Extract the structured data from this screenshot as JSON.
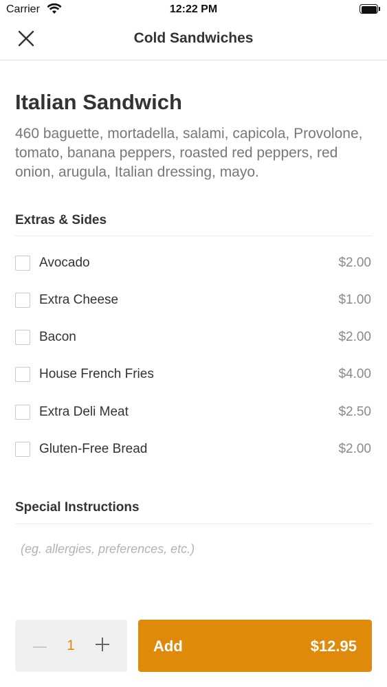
{
  "status_bar": {
    "carrier": "Carrier",
    "time": "12:22 PM"
  },
  "header": {
    "title": "Cold Sandwiches",
    "close_icon": "close-icon"
  },
  "item": {
    "name": "Italian Sandwich",
    "description": "460 baguette, mortadella, salami, capicola, Provolone, tomato, banana peppers, roasted red peppers, red onion, arugula, Italian dressing, mayo."
  },
  "extras": {
    "title": "Extras & Sides",
    "options": [
      {
        "name": "Avocado",
        "price": "$2.00",
        "checked": false
      },
      {
        "name": "Extra Cheese",
        "price": "$1.00",
        "checked": false
      },
      {
        "name": "Bacon",
        "price": "$2.00",
        "checked": false
      },
      {
        "name": "House French Fries",
        "price": "$4.00",
        "checked": false
      },
      {
        "name": "Extra Deli Meat",
        "price": "$2.50",
        "checked": false
      },
      {
        "name": "Gluten-Free Bread",
        "price": "$2.00",
        "checked": false
      }
    ]
  },
  "instructions": {
    "title": "Special Instructions",
    "placeholder": "(eg. allergies, preferences, etc.)",
    "value": ""
  },
  "footer": {
    "quantity": "1",
    "minus_icon": "minus-icon",
    "plus_icon": "plus-icon",
    "add_label": "Add",
    "total": "$12.95"
  },
  "colors": {
    "accent": "#e08a0b",
    "text_primary": "#333333",
    "text_secondary": "#777777",
    "price": "#8a8a8a",
    "placeholder": "#b3b3b3",
    "stepper_bg": "#f0f0f0",
    "divider": "#ececec"
  }
}
